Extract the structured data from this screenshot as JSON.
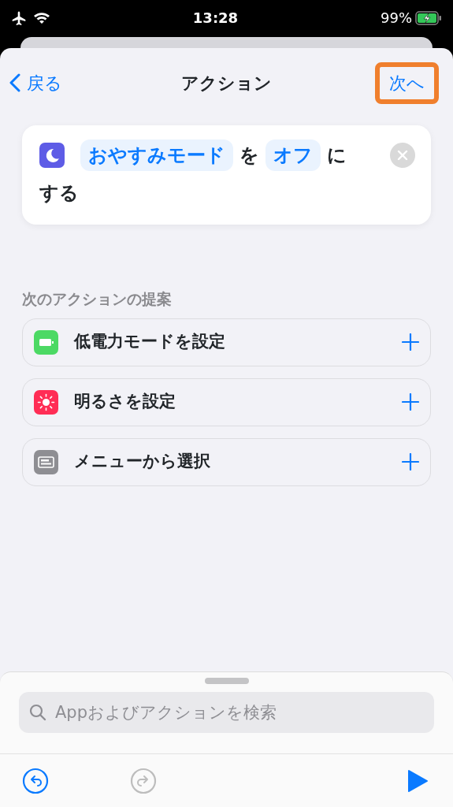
{
  "status_bar": {
    "time": "13:28",
    "battery": "99%"
  },
  "nav": {
    "back": "戻る",
    "title": "アクション",
    "next": {
      "label": "次へ",
      "highlighted": true
    }
  },
  "action": {
    "color": "#5e5ce6",
    "tokens": [
      {
        "kind": "param",
        "text": "おやすみモード"
      },
      {
        "kind": "text",
        "text": "を"
      },
      {
        "kind": "param",
        "text": "オフ"
      },
      {
        "kind": "text",
        "text": "に"
      },
      {
        "kind": "text",
        "text": "する"
      }
    ]
  },
  "suggestions": {
    "title": "次のアクションの提案",
    "items": [
      {
        "kind": "battery",
        "color": "#4cd964",
        "label": "低電力モードを設定"
      },
      {
        "kind": "sun",
        "color": "#ff2d55",
        "label": "明るさを設定"
      },
      {
        "kind": "menu",
        "color": "#8e8e93",
        "label": "メニューから選択"
      }
    ]
  },
  "search": {
    "placeholder": "Appおよびアクションを検索"
  },
  "toolbar": {
    "undo": {
      "disabled": false
    },
    "redo": {
      "disabled": true
    }
  }
}
